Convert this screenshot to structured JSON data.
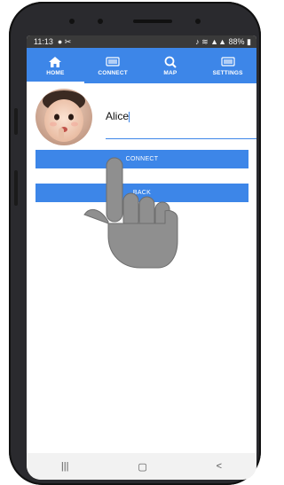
{
  "status_bar": {
    "time": "11:13",
    "battery": "88%"
  },
  "tabs": [
    {
      "label": "HOME",
      "icon": "home-icon"
    },
    {
      "label": "CONNECT",
      "icon": "connect-icon"
    },
    {
      "label": "MAP",
      "icon": "search-icon"
    },
    {
      "label": "SETTINGS",
      "icon": "settings-icon"
    }
  ],
  "active_tab": "HOME",
  "profile": {
    "name_value": "Alice"
  },
  "buttons": {
    "connect_label": "CONNECT",
    "back_label": "BACK"
  },
  "nav": {
    "recents_glyph": "|||",
    "home_glyph": "▢",
    "back_glyph": "<"
  },
  "colors": {
    "accent": "#3d86e8",
    "status_bar": "#3a3a3a",
    "frame": "#2a2a2e"
  }
}
